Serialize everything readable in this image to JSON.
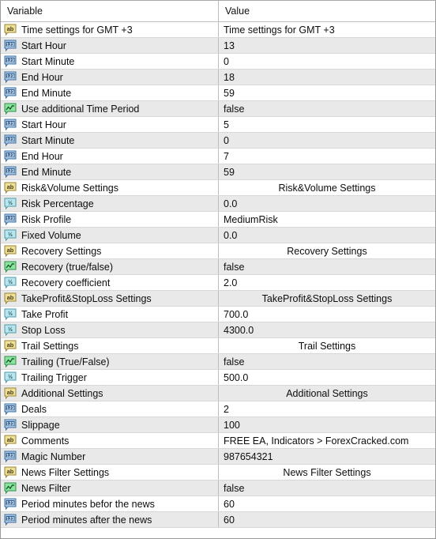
{
  "header": {
    "variable_label": "Variable",
    "value_label": "Value"
  },
  "colors": {
    "row_even": "#ffffff",
    "row_odd": "#e9e9e9",
    "grid_line": "#d7d7d7",
    "column_divider": "#bdbdbd",
    "frame_border": "#9a9a9a",
    "text": "#0d0d0d",
    "icon_string": "#e8d26a",
    "icon_integer": "#5b9bd5",
    "icon_double": "#7fd3e0",
    "icon_bool": "#5fcf7a"
  },
  "rows": [
    {
      "icon": "string-variable-icon",
      "type": "string",
      "label": "Time settings for GMT +3",
      "value": "Time settings for GMT +3",
      "align": "left"
    },
    {
      "icon": "integer-variable-icon",
      "type": "integer",
      "label": "Start Hour",
      "value": "13",
      "align": "left"
    },
    {
      "icon": "integer-variable-icon",
      "type": "integer",
      "label": "Start Minute",
      "value": "0",
      "align": "left"
    },
    {
      "icon": "integer-variable-icon",
      "type": "integer",
      "label": "End Hour",
      "value": "18",
      "align": "left"
    },
    {
      "icon": "integer-variable-icon",
      "type": "integer",
      "label": "End Minute",
      "value": "59",
      "align": "left"
    },
    {
      "icon": "bool-variable-icon",
      "type": "bool",
      "label": "Use additional Time Period",
      "value": "false",
      "align": "left"
    },
    {
      "icon": "integer-variable-icon",
      "type": "integer",
      "label": "Start Hour",
      "value": "5",
      "align": "left"
    },
    {
      "icon": "integer-variable-icon",
      "type": "integer",
      "label": "Start Minute",
      "value": "0",
      "align": "left"
    },
    {
      "icon": "integer-variable-icon",
      "type": "integer",
      "label": "End Hour",
      "value": "7",
      "align": "left"
    },
    {
      "icon": "integer-variable-icon",
      "type": "integer",
      "label": "End Minute",
      "value": "59",
      "align": "left"
    },
    {
      "icon": "string-variable-icon",
      "type": "string",
      "label": "Risk&Volume Settings",
      "value": "Risk&Volume Settings",
      "align": "center"
    },
    {
      "icon": "double-variable-icon",
      "type": "double",
      "label": "Risk Percentage",
      "value": "0.0",
      "align": "left"
    },
    {
      "icon": "integer-variable-icon",
      "type": "integer",
      "label": "Risk Profile",
      "value": "MediumRisk",
      "align": "left"
    },
    {
      "icon": "double-variable-icon",
      "type": "double",
      "label": "Fixed Volume",
      "value": "0.0",
      "align": "left"
    },
    {
      "icon": "string-variable-icon",
      "type": "string",
      "label": "Recovery Settings",
      "value": "Recovery Settings",
      "align": "center"
    },
    {
      "icon": "bool-variable-icon",
      "type": "bool",
      "label": "Recovery (true/false)",
      "value": "false",
      "align": "left"
    },
    {
      "icon": "double-variable-icon",
      "type": "double",
      "label": "Recovery coefficient",
      "value": "2.0",
      "align": "left"
    },
    {
      "icon": "string-variable-icon",
      "type": "string",
      "label": "TakeProfit&StopLoss Settings",
      "value": "TakeProfit&StopLoss Settings",
      "align": "center"
    },
    {
      "icon": "double-variable-icon",
      "type": "double",
      "label": "Take Profit",
      "value": "700.0",
      "align": "left"
    },
    {
      "icon": "double-variable-icon",
      "type": "double",
      "label": "Stop Loss",
      "value": "4300.0",
      "align": "left"
    },
    {
      "icon": "string-variable-icon",
      "type": "string",
      "label": "Trail Settings",
      "value": "Trail Settings",
      "align": "center"
    },
    {
      "icon": "bool-variable-icon",
      "type": "bool",
      "label": "Trailing (True/False)",
      "value": "false",
      "align": "left"
    },
    {
      "icon": "double-variable-icon",
      "type": "double",
      "label": "Trailing Trigger",
      "value": "500.0",
      "align": "left"
    },
    {
      "icon": "string-variable-icon",
      "type": "string",
      "label": "Additional Settings",
      "value": "Additional Settings",
      "align": "center"
    },
    {
      "icon": "integer-variable-icon",
      "type": "integer",
      "label": "Deals",
      "value": "2",
      "align": "left"
    },
    {
      "icon": "integer-variable-icon",
      "type": "integer",
      "label": "Slippage",
      "value": "100",
      "align": "left"
    },
    {
      "icon": "string-variable-icon",
      "type": "string",
      "label": "Comments",
      "value": "FREE EA, Indicators > ForexCracked.com",
      "align": "left"
    },
    {
      "icon": "integer-variable-icon",
      "type": "integer",
      "label": "Magic Number",
      "value": "987654321",
      "align": "left"
    },
    {
      "icon": "string-variable-icon",
      "type": "string",
      "label": "News Filter Settings",
      "value": "News Filter Settings",
      "align": "center"
    },
    {
      "icon": "bool-variable-icon",
      "type": "bool",
      "label": "News Filter",
      "value": "false",
      "align": "left"
    },
    {
      "icon": "integer-variable-icon",
      "type": "integer",
      "label": "Period minutes befor the news",
      "value": "60",
      "align": "left"
    },
    {
      "icon": "integer-variable-icon",
      "type": "integer",
      "label": "Period minutes after the news",
      "value": "60",
      "align": "left"
    }
  ]
}
